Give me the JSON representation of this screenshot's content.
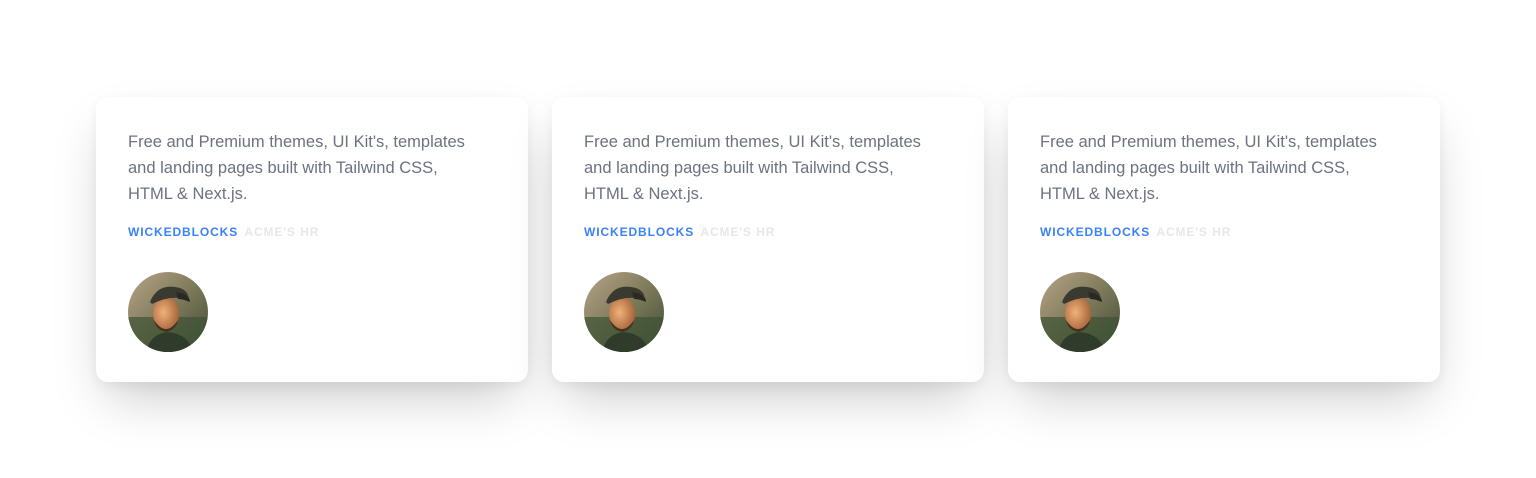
{
  "testimonials": [
    {
      "quote": "Free and Premium themes, UI Kit's, templates and landing pages built with Tailwind CSS, HTML & Next.js.",
      "company": "WICKEDBLOCKS",
      "role": "ACME'S HR",
      "avatar_icon": "person-portrait-photo"
    },
    {
      "quote": "Free and Premium themes, UI Kit's, templates and landing pages built with Tailwind CSS, HTML & Next.js.",
      "company": "WICKEDBLOCKS",
      "role": "ACME'S HR",
      "avatar_icon": "person-portrait-photo"
    },
    {
      "quote": "Free and Premium themes, UI Kit's, templates and landing pages built with Tailwind CSS, HTML & Next.js.",
      "company": "WICKEDBLOCKS",
      "role": "ACME'S HR",
      "avatar_icon": "person-portrait-photo"
    }
  ],
  "colors": {
    "quote_text": "#6b7280",
    "company_accent": "#3b82f6",
    "role_text": "#e5e7eb",
    "card_bg": "#ffffff"
  }
}
